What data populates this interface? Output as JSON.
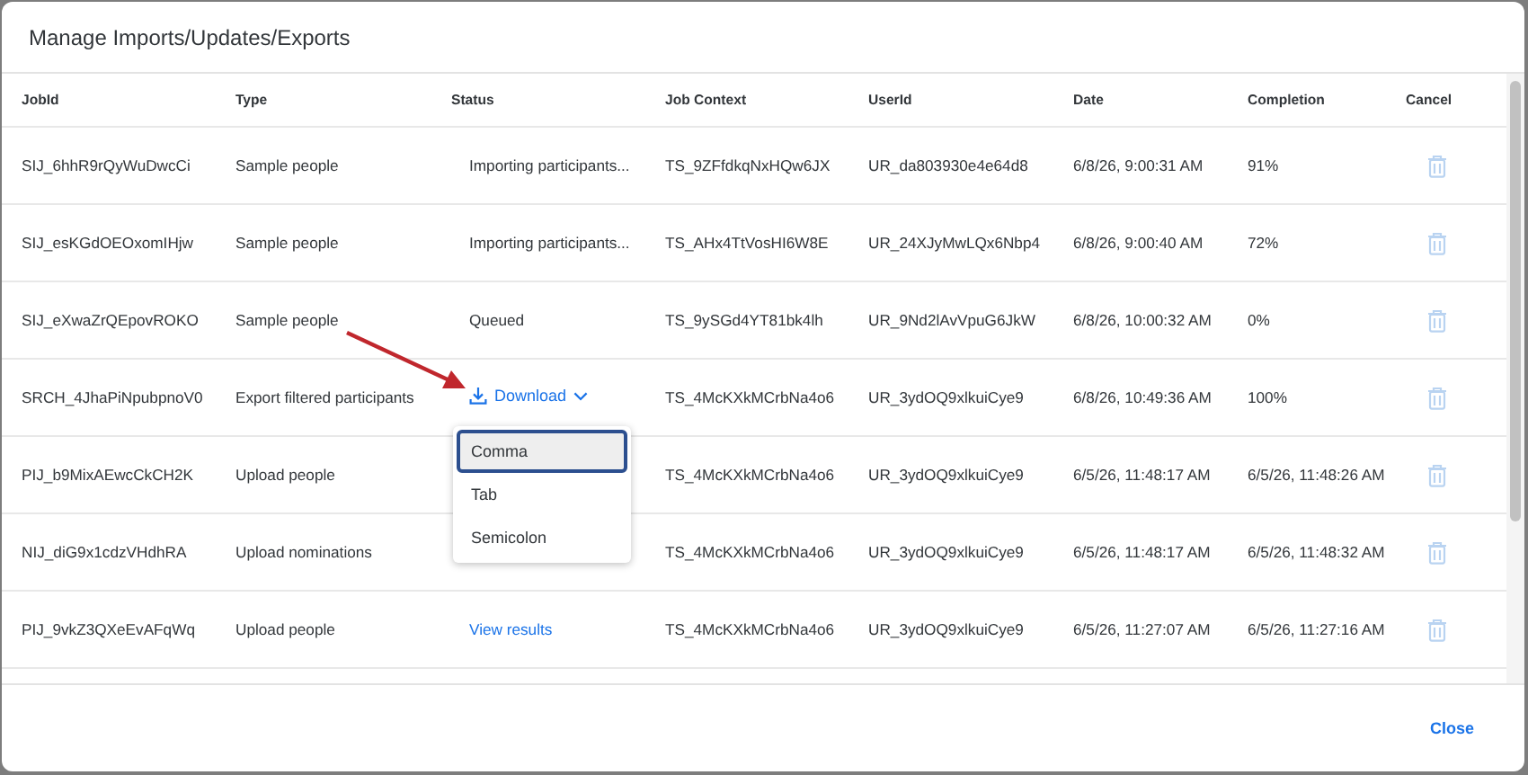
{
  "dialog": {
    "title": "Manage Imports/Updates/Exports"
  },
  "table": {
    "columns": [
      "JobId",
      "Type",
      "Status",
      "Job Context",
      "UserId",
      "Date",
      "Completion",
      "Cancel"
    ],
    "rows": [
      {
        "job_id": "SIJ_6hhR9rQyWuDwcCi",
        "type": "Sample people",
        "status": {
          "kind": "text",
          "label": "Importing participants..."
        },
        "job_context": "TS_9ZFfdkqNxHQw6JX",
        "user_id": "UR_da803930e4e64d8",
        "date": "6/8/26, 9:00:31 AM",
        "completion": "91%"
      },
      {
        "job_id": "SIJ_esKGdOEOxomIHjw",
        "type": "Sample people",
        "status": {
          "kind": "text",
          "label": "Importing participants..."
        },
        "job_context": "TS_AHx4TtVosHI6W8E",
        "user_id": "UR_24XJyMwLQx6Nbp4",
        "date": "6/8/26, 9:00:40 AM",
        "completion": "72%"
      },
      {
        "job_id": "SIJ_eXwaZrQEpovROKO",
        "type": "Sample people",
        "status": {
          "kind": "text",
          "label": "Queued"
        },
        "job_context": "TS_9ySGd4YT81bk4lh",
        "user_id": "UR_9Nd2lAvVpuG6JkW",
        "date": "6/8/26, 10:00:32 AM",
        "completion": "0%"
      },
      {
        "job_id": "SRCH_4JhaPiNpubpnoV0",
        "type": "Export filtered participants",
        "status": {
          "kind": "download",
          "label": "Download"
        },
        "job_context": "TS_4McKXkMCrbNa4o6",
        "user_id": "UR_3ydOQ9xlkuiCye9",
        "date": "6/8/26, 10:49:36 AM",
        "completion": "100%"
      },
      {
        "job_id": "PIJ_b9MixAEwcCkCH2K",
        "type": "Upload people",
        "job_context": "TS_4McKXkMCrbNa4o6",
        "user_id": "UR_3ydOQ9xlkuiCye9",
        "date": "6/5/26, 11:48:17 AM",
        "completion": "6/5/26, 11:48:26 AM"
      },
      {
        "job_id": "NIJ_diG9x1cdzVHdhRA",
        "type": "Upload nominations",
        "job_context": "TS_4McKXkMCrbNa4o6",
        "user_id": "UR_3ydOQ9xlkuiCye9",
        "date": "6/5/26, 11:48:17 AM",
        "completion": "6/5/26, 11:48:32 AM"
      },
      {
        "job_id": "PIJ_9vkZ3QXeEvAFqWq",
        "type": "Upload people",
        "status": {
          "kind": "link",
          "label": "View results"
        },
        "job_context": "TS_4McKXkMCrbNa4o6",
        "user_id": "UR_3ydOQ9xlkuiCye9",
        "date": "6/5/26, 11:27:07 AM",
        "completion": "6/5/26, 11:27:16 AM"
      }
    ]
  },
  "format_menu": {
    "options": [
      {
        "label": "Comma",
        "selected": true
      },
      {
        "label": "Tab",
        "selected": false
      },
      {
        "label": "Semicolon",
        "selected": false
      }
    ]
  },
  "footer": {
    "close": "Close"
  }
}
